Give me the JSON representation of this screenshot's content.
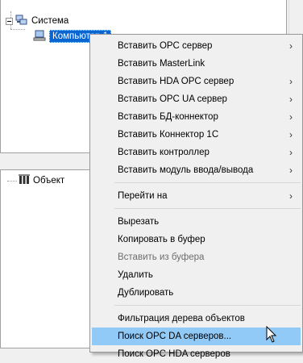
{
  "tree": {
    "root_label": "Система",
    "selected_label": "Компьютер 1"
  },
  "objects": {
    "root_label": "Объект"
  },
  "menu": {
    "groups": [
      [
        {
          "label": "Вставить OPC сервер",
          "submenu": true
        },
        {
          "label": "Вставить MasterLink",
          "submenu": false
        },
        {
          "label": "Вставить HDA OPC сервер",
          "submenu": true
        },
        {
          "label": "Вставить OPC UA сервер",
          "submenu": true
        },
        {
          "label": "Вставить БД-коннектор",
          "submenu": true
        },
        {
          "label": "Вставить Коннектор 1С",
          "submenu": true
        },
        {
          "label": "Вставить контроллер",
          "submenu": true
        },
        {
          "label": "Вставить модуль ввода/вывода",
          "submenu": true
        }
      ],
      [
        {
          "label": "Перейти на",
          "submenu": true
        }
      ],
      [
        {
          "label": "Вырезать"
        },
        {
          "label": "Копировать в буфер"
        },
        {
          "label": "Вставить из буфера",
          "disabled": true
        },
        {
          "label": "Удалить"
        },
        {
          "label": "Дублировать"
        }
      ],
      [
        {
          "label": "Фильтрация дерева объектов"
        },
        {
          "label": "Поиск OPC DA серверов...",
          "highlighted": true
        },
        {
          "label": "Поиск OPC HDA серверов"
        }
      ]
    ],
    "submenu_arrow": "›"
  },
  "colors": {
    "selection": "#0a64d2",
    "menu_highlight": "#91c9f7",
    "menu_background": "#f0f0f0"
  }
}
